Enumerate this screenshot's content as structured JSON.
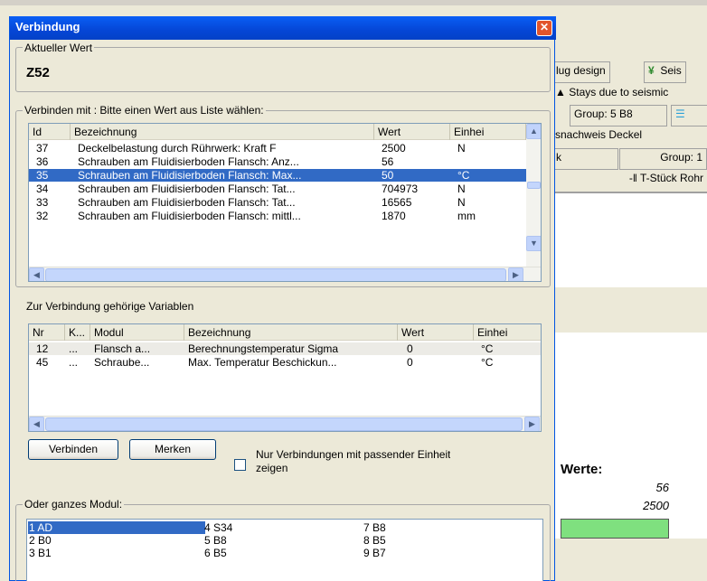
{
  "background": {
    "tabs": {
      "plug_design": "lug design",
      "seismic": "Seis",
      "stays": "Stays due to seismic",
      "group1": "Group: 5 B8",
      "nachweis": "snachweis Deckel",
      "k": "k",
      "group2": "Group: 1",
      "tstueck": "T-Stück Rohr"
    },
    "werte_label": "Werte:",
    "values": [
      "56",
      "2500"
    ],
    "colors": {
      "green_bar": "#7fe07f"
    }
  },
  "dialog": {
    "title": "Verbindung",
    "current_group_label": "Aktueller Wert",
    "current_value": "Z52",
    "connect_group_label": "Verbinden mit : Bitte einen Wert aus Liste wählen:",
    "list1": {
      "columns": [
        "Id",
        "Bezeichnung",
        "Wert",
        "Einhei"
      ],
      "rows": [
        {
          "id": "37",
          "name": "Deckelbelastung durch Rührwerk: Kraft F",
          "value": "2500",
          "unit": "N"
        },
        {
          "id": "36",
          "name": "Schrauben am Fluidisierboden Flansch: Anz...",
          "value": "56",
          "unit": ""
        },
        {
          "id": "35",
          "name": "Schrauben am Fluidisierboden Flansch: Max...",
          "value": "50",
          "unit": "°C"
        },
        {
          "id": "34",
          "name": "Schrauben am Fluidisierboden Flansch: Tat...",
          "value": "704973",
          "unit": "N"
        },
        {
          "id": "33",
          "name": "Schrauben am Fluidisierboden Flansch: Tat...",
          "value": "16565",
          "unit": "N"
        },
        {
          "id": "32",
          "name": "Schrauben am Fluidisierboden Flansch: mittl...",
          "value": "1870",
          "unit": "mm"
        }
      ],
      "selected_index": 2
    },
    "vars_label": "Zur Verbindung gehörige Variablen",
    "list2": {
      "columns": [
        "Nr",
        "K...",
        "Modul",
        "Bezeichnung",
        "Wert",
        "Einhei"
      ],
      "rows": [
        {
          "nr": "12",
          "k": "...",
          "modul": "Flansch a...",
          "name": "Berechnungstemperatur Sigma",
          "value": "0",
          "unit": "°C"
        },
        {
          "nr": "45",
          "k": "...",
          "modul": "Schraube...",
          "name": "Max. Temperatur Beschickun...",
          "value": "0",
          "unit": "°C"
        }
      ]
    },
    "buttons": {
      "connect": "Verbinden",
      "remember": "Merken"
    },
    "checkbox_label_1": "Nur Verbindungen mit passender Einheit",
    "checkbox_label_2": "zeigen",
    "module_group_label": "Oder ganzes Modul:",
    "modules": [
      [
        "1 AD",
        "2 B0",
        "3 B1"
      ],
      [
        "4 S34",
        "5 B8",
        "6 B5"
      ],
      [
        "7 B8",
        "8 B5",
        "9 B7"
      ]
    ]
  }
}
